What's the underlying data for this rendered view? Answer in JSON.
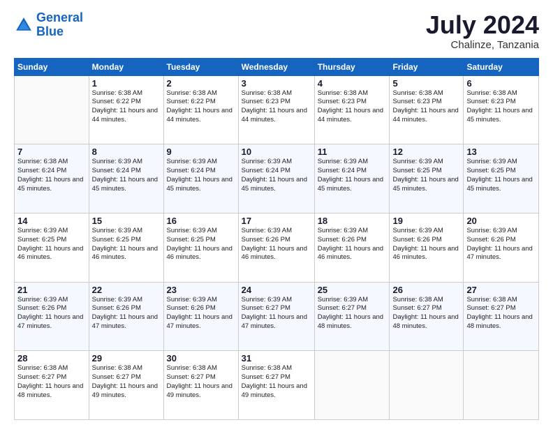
{
  "logo": {
    "line1": "General",
    "line2": "Blue"
  },
  "title": "July 2024",
  "subtitle": "Chalinze, Tanzania",
  "weekdays": [
    "Sunday",
    "Monday",
    "Tuesday",
    "Wednesday",
    "Thursday",
    "Friday",
    "Saturday"
  ],
  "weeks": [
    [
      {
        "day": "",
        "sunrise": "",
        "sunset": "",
        "daylight": ""
      },
      {
        "day": "1",
        "sunrise": "Sunrise: 6:38 AM",
        "sunset": "Sunset: 6:22 PM",
        "daylight": "Daylight: 11 hours and 44 minutes."
      },
      {
        "day": "2",
        "sunrise": "Sunrise: 6:38 AM",
        "sunset": "Sunset: 6:22 PM",
        "daylight": "Daylight: 11 hours and 44 minutes."
      },
      {
        "day": "3",
        "sunrise": "Sunrise: 6:38 AM",
        "sunset": "Sunset: 6:23 PM",
        "daylight": "Daylight: 11 hours and 44 minutes."
      },
      {
        "day": "4",
        "sunrise": "Sunrise: 6:38 AM",
        "sunset": "Sunset: 6:23 PM",
        "daylight": "Daylight: 11 hours and 44 minutes."
      },
      {
        "day": "5",
        "sunrise": "Sunrise: 6:38 AM",
        "sunset": "Sunset: 6:23 PM",
        "daylight": "Daylight: 11 hours and 44 minutes."
      },
      {
        "day": "6",
        "sunrise": "Sunrise: 6:38 AM",
        "sunset": "Sunset: 6:23 PM",
        "daylight": "Daylight: 11 hours and 45 minutes."
      }
    ],
    [
      {
        "day": "7",
        "sunrise": "Sunrise: 6:38 AM",
        "sunset": "Sunset: 6:24 PM",
        "daylight": "Daylight: 11 hours and 45 minutes."
      },
      {
        "day": "8",
        "sunrise": "Sunrise: 6:39 AM",
        "sunset": "Sunset: 6:24 PM",
        "daylight": "Daylight: 11 hours and 45 minutes."
      },
      {
        "day": "9",
        "sunrise": "Sunrise: 6:39 AM",
        "sunset": "Sunset: 6:24 PM",
        "daylight": "Daylight: 11 hours and 45 minutes."
      },
      {
        "day": "10",
        "sunrise": "Sunrise: 6:39 AM",
        "sunset": "Sunset: 6:24 PM",
        "daylight": "Daylight: 11 hours and 45 minutes."
      },
      {
        "day": "11",
        "sunrise": "Sunrise: 6:39 AM",
        "sunset": "Sunset: 6:24 PM",
        "daylight": "Daylight: 11 hours and 45 minutes."
      },
      {
        "day": "12",
        "sunrise": "Sunrise: 6:39 AM",
        "sunset": "Sunset: 6:25 PM",
        "daylight": "Daylight: 11 hours and 45 minutes."
      },
      {
        "day": "13",
        "sunrise": "Sunrise: 6:39 AM",
        "sunset": "Sunset: 6:25 PM",
        "daylight": "Daylight: 11 hours and 45 minutes."
      }
    ],
    [
      {
        "day": "14",
        "sunrise": "Sunrise: 6:39 AM",
        "sunset": "Sunset: 6:25 PM",
        "daylight": "Daylight: 11 hours and 46 minutes."
      },
      {
        "day": "15",
        "sunrise": "Sunrise: 6:39 AM",
        "sunset": "Sunset: 6:25 PM",
        "daylight": "Daylight: 11 hours and 46 minutes."
      },
      {
        "day": "16",
        "sunrise": "Sunrise: 6:39 AM",
        "sunset": "Sunset: 6:25 PM",
        "daylight": "Daylight: 11 hours and 46 minutes."
      },
      {
        "day": "17",
        "sunrise": "Sunrise: 6:39 AM",
        "sunset": "Sunset: 6:26 PM",
        "daylight": "Daylight: 11 hours and 46 minutes."
      },
      {
        "day": "18",
        "sunrise": "Sunrise: 6:39 AM",
        "sunset": "Sunset: 6:26 PM",
        "daylight": "Daylight: 11 hours and 46 minutes."
      },
      {
        "day": "19",
        "sunrise": "Sunrise: 6:39 AM",
        "sunset": "Sunset: 6:26 PM",
        "daylight": "Daylight: 11 hours and 46 minutes."
      },
      {
        "day": "20",
        "sunrise": "Sunrise: 6:39 AM",
        "sunset": "Sunset: 6:26 PM",
        "daylight": "Daylight: 11 hours and 47 minutes."
      }
    ],
    [
      {
        "day": "21",
        "sunrise": "Sunrise: 6:39 AM",
        "sunset": "Sunset: 6:26 PM",
        "daylight": "Daylight: 11 hours and 47 minutes."
      },
      {
        "day": "22",
        "sunrise": "Sunrise: 6:39 AM",
        "sunset": "Sunset: 6:26 PM",
        "daylight": "Daylight: 11 hours and 47 minutes."
      },
      {
        "day": "23",
        "sunrise": "Sunrise: 6:39 AM",
        "sunset": "Sunset: 6:26 PM",
        "daylight": "Daylight: 11 hours and 47 minutes."
      },
      {
        "day": "24",
        "sunrise": "Sunrise: 6:39 AM",
        "sunset": "Sunset: 6:27 PM",
        "daylight": "Daylight: 11 hours and 47 minutes."
      },
      {
        "day": "25",
        "sunrise": "Sunrise: 6:39 AM",
        "sunset": "Sunset: 6:27 PM",
        "daylight": "Daylight: 11 hours and 48 minutes."
      },
      {
        "day": "26",
        "sunrise": "Sunrise: 6:38 AM",
        "sunset": "Sunset: 6:27 PM",
        "daylight": "Daylight: 11 hours and 48 minutes."
      },
      {
        "day": "27",
        "sunrise": "Sunrise: 6:38 AM",
        "sunset": "Sunset: 6:27 PM",
        "daylight": "Daylight: 11 hours and 48 minutes."
      }
    ],
    [
      {
        "day": "28",
        "sunrise": "Sunrise: 6:38 AM",
        "sunset": "Sunset: 6:27 PM",
        "daylight": "Daylight: 11 hours and 48 minutes."
      },
      {
        "day": "29",
        "sunrise": "Sunrise: 6:38 AM",
        "sunset": "Sunset: 6:27 PM",
        "daylight": "Daylight: 11 hours and 49 minutes."
      },
      {
        "day": "30",
        "sunrise": "Sunrise: 6:38 AM",
        "sunset": "Sunset: 6:27 PM",
        "daylight": "Daylight: 11 hours and 49 minutes."
      },
      {
        "day": "31",
        "sunrise": "Sunrise: 6:38 AM",
        "sunset": "Sunset: 6:27 PM",
        "daylight": "Daylight: 11 hours and 49 minutes."
      },
      {
        "day": "",
        "sunrise": "",
        "sunset": "",
        "daylight": ""
      },
      {
        "day": "",
        "sunrise": "",
        "sunset": "",
        "daylight": ""
      },
      {
        "day": "",
        "sunrise": "",
        "sunset": "",
        "daylight": ""
      }
    ]
  ]
}
